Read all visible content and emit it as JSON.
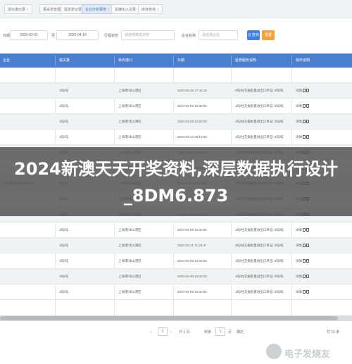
{
  "tabs": [
    {
      "label": "进出港记录",
      "active": false
    },
    {
      "label": "报关单管理",
      "active": false
    },
    {
      "label": "提货单记录",
      "active": false
    },
    {
      "label": "企业分析报告",
      "active": true
    },
    {
      "label": "车辆出入记录",
      "active": false
    },
    {
      "label": "库存查询",
      "active": false
    }
  ],
  "filters": {
    "date_label": "日期",
    "date_start": "2020-03-01",
    "to_label": "至",
    "date_end": "2020-04-14",
    "status_label": "行程状态",
    "status_placeholder": "请选择报关状态",
    "company_label": "企业名称",
    "company_placeholder": "请选择企业",
    "query_label": "Q 查询",
    "reset_label": "重置"
  },
  "table": {
    "headers": [
      "企业",
      "报关量",
      "目的港口",
      "日期",
      "监管服务说明",
      "操作说明"
    ],
    "rows": [
      {
        "company": "",
        "qty": "",
        "port": "",
        "date": "",
        "desc": "",
        "ops": ""
      },
      {
        "company": "",
        "qty": "1吨/吨",
        "port": "上海港/洋山港区",
        "date": "2020-03-25 17:44:18",
        "desc": "0吨/柱交报批量进出口单证/ 3吨/吨",
        "ops": "详情"
      },
      {
        "company": "",
        "qty": "1吨/吨",
        "port": "上海港/洋山港区",
        "date": "2020-04-09 10:30:00",
        "desc": "1吨/柱交报批量进出口单证/ 3吨/吨",
        "ops": "详情"
      },
      {
        "company": "",
        "qty": "1吨/吨",
        "port": "上海港/洋山港区",
        "date": "2020-04-08 12:50:00",
        "desc": "1吨/柱交报批量进出口单证/ 3吨/吨",
        "ops": "详情"
      },
      {
        "company": "",
        "qty": "1吨/吨",
        "port": "上海港/洋山港区",
        "date": "2020-04-13 09:10:00",
        "desc": "1吨/柱交报批量进出口单证/ 3吨/吨",
        "ops": "详情"
      },
      {
        "company": "",
        "qty": "1吨/吨",
        "port": "上海港/洋山港区",
        "date": "2020-04-13 10:00:00",
        "desc": "1吨/柱交报批量进出口单证/ 3吨/吨",
        "ops": "详情"
      },
      {
        "company": "",
        "qty": "1吨/吨",
        "port": "上海港/洋山港区",
        "date": "2020-04-08 10:00:00",
        "desc": "1吨/柱交报批量进出口单证/ 3吨/吨",
        "ops": "详情"
      },
      {
        "company": "上海港洋山港区分公司",
        "qty": "1吨/吨",
        "port": "上海港/洋山港区",
        "date": "2020-04-10 10:00:00",
        "desc": "1吨/柱交报批量进出口单证/ 3吨/吨",
        "ops": "详情"
      },
      {
        "company": "",
        "qty": "1吨/吨",
        "port": "上海港/洋山港区",
        "date": "2020-04-10 10:00:00",
        "desc": "1吨/柱交报批量进出口单证/ 3吨/吨",
        "ops": "详情"
      },
      {
        "company": "",
        "qty": "1吨/吨",
        "port": "上海港/洋山港区",
        "date": "2020-04-09 10:30:00",
        "desc": "1吨/柱交报批量进出口单证/ 3吨/吨",
        "ops": "详情"
      },
      {
        "company": "",
        "qty": "1吨/吨",
        "port": "上海港/洋山港区",
        "date": "2020-04-09 16:00:00",
        "desc": "1吨/柱交报批量进出口单证/ 3吨/吨",
        "ops": "详情"
      },
      {
        "company": "",
        "qty": "1吨/吨",
        "port": "上海港/洋山港区",
        "date": "2020-03-21 11:20:47",
        "desc": "0吨/柱交报批量进出口单证/ 3吨/吨",
        "ops": "详情"
      },
      {
        "company": "",
        "qty": "1吨/吨",
        "port": "上海港/洋山港区",
        "date": "2020-04-09 14:00:00",
        "desc": "1吨/柱交报批量进出口单证/ 3吨/吨",
        "ops": "详情"
      },
      {
        "company": "",
        "qty": "1吨/吨",
        "port": "上海港/洋山港区",
        "date": "2020-04-08 10:00:00",
        "desc": "1吨/柱交报批量进出口单证/ 3吨/吨",
        "ops": "详情"
      },
      {
        "company": "",
        "qty": "1吨/吨",
        "port": "上海港/洋山港区",
        "date": "2020-04-09 10:00:00",
        "desc": "1吨/柱交报批量进出口单证/ 3吨/吨",
        "ops": "详情"
      }
    ]
  },
  "pager": {
    "prev": "‹",
    "page": "1",
    "next": "›",
    "total": "共 1 页",
    "goto_label": "到第",
    "goto_value": "1",
    "page_unit": "页",
    "confirm": "确定",
    "count": "共 15 条"
  },
  "banner": {
    "title": "2024新澳天天开奖资料,深层数据执行设计_8DM6.873"
  },
  "watermark": {
    "text": "电子发烧友"
  },
  "colors": {
    "header_blue": "#4a7fd0",
    "active_tab": "#e3ebf8",
    "query_button": "#3f7fe0",
    "reset_button": "#f5a23c",
    "banner_overlay": "#4e4e4e"
  }
}
